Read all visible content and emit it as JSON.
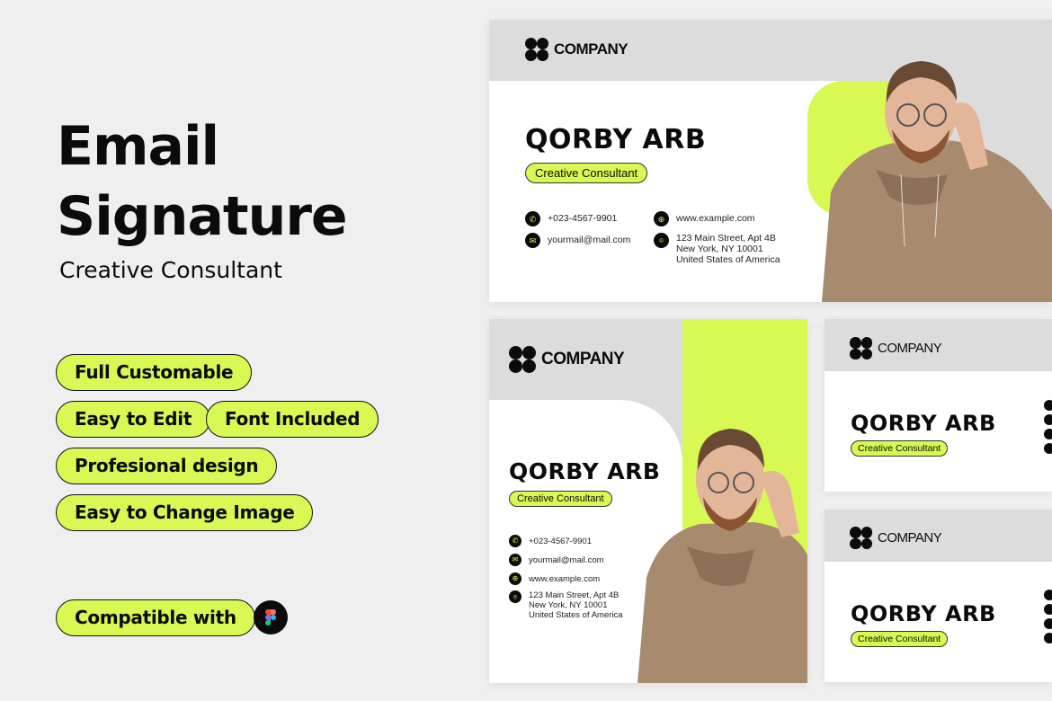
{
  "hero": {
    "title_line1": "Email",
    "title_line2": "Signature",
    "subtitle": "Creative Consultant"
  },
  "features": [
    "Full Customable",
    "Easy to Edit",
    "Font Included",
    "Profesional design",
    "Easy to Change Image"
  ],
  "compatible": {
    "label": "Compatible with",
    "icon": "figma-icon"
  },
  "colors": {
    "accent": "#d8f853",
    "dark": "#0b0b0b",
    "header_gray": "#dcdcdc",
    "background": "#efefef",
    "hoodie": "#a88a6e"
  },
  "signature": {
    "company": "COMPANY",
    "name": "QORBY ARB",
    "role": "Creative Consultant",
    "phone": "+023-4567-9901",
    "email": "yourmail@mail.com",
    "website": "www.example.com",
    "address_line1": "123 Main Street, Apt 4B",
    "address_line2": "New York, NY 10001",
    "address_line3": "United States of America"
  },
  "icons": {
    "phone": "✆",
    "email": "✉",
    "web": "⊕",
    "location": "⌾"
  }
}
